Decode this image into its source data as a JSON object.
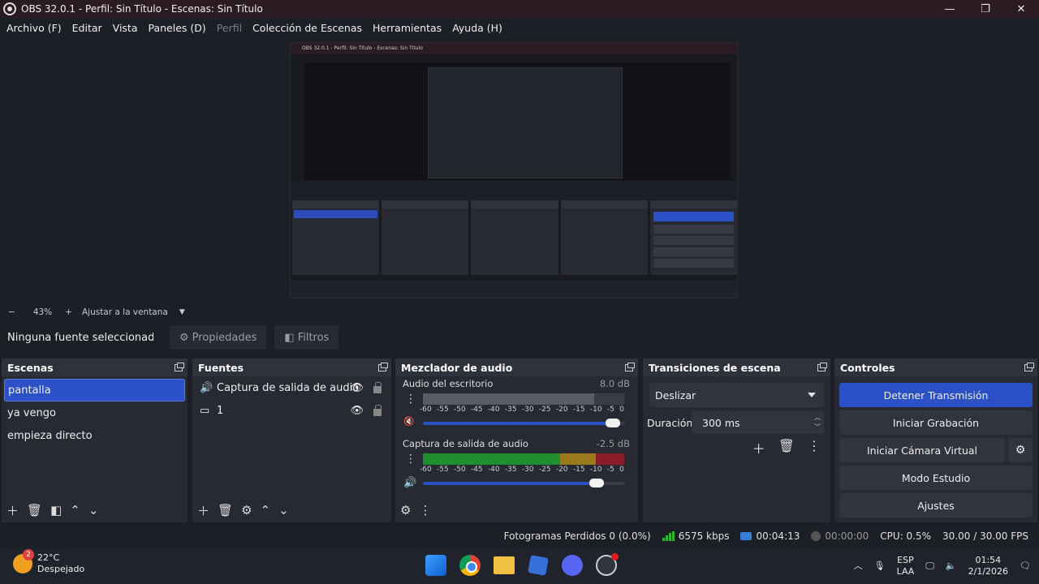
{
  "window": {
    "title": "OBS 32.0.1 - Perfil: Sin Título - Escenas: Sin Título",
    "minimize": "—",
    "maximize": "❐",
    "close": "✕"
  },
  "menu": {
    "items": [
      "Archivo (F)",
      "Editar",
      "Vista",
      "Paneles (D)",
      "Perfil",
      "Colección de Escenas",
      "Herramientas",
      "Ayuda (H)"
    ]
  },
  "zoom": {
    "minus": "−",
    "value": "43%",
    "plus": "+",
    "fit_label": "Ajustar a la ventana"
  },
  "source_toolbar": {
    "no_source": "Ninguna fuente seleccionada",
    "properties": "Propiedades",
    "filters": "Filtros"
  },
  "scenes": {
    "title": "Escenas",
    "items": [
      "pantalla",
      "ya vengo",
      "empieza directo"
    ],
    "selected_index": 0
  },
  "sources": {
    "title": "Fuentes",
    "items": [
      {
        "label": "Captura de salida de audio",
        "icon": "speaker-icon"
      },
      {
        "label": "1",
        "icon": "monitor-icon"
      }
    ]
  },
  "mixer": {
    "title": "Mezclador de audio",
    "ticks": [
      "-60",
      "-55",
      "-50",
      "-45",
      "-40",
      "-35",
      "-30",
      "-25",
      "-20",
      "-15",
      "-10",
      "-5",
      "0"
    ],
    "channels": [
      {
        "name": "Audio del escritorio",
        "db": "8.0 dB",
        "muted": true,
        "volume": 0.98,
        "level": 0.85
      },
      {
        "name": "Captura de salida de audio",
        "db": "-2.5 dB",
        "muted": false,
        "volume": 0.9,
        "level": 1.0
      }
    ]
  },
  "transitions": {
    "title": "Transiciones de escena",
    "selected": "Deslizar",
    "duration_label": "Duración",
    "duration_value": "300 ms"
  },
  "controls": {
    "title": "Controles",
    "stop_stream": "Detener Transmisión",
    "start_recording": "Iniciar Grabación",
    "start_virtual_cam": "Iniciar Cámara Virtual",
    "studio_mode": "Modo Estudio",
    "settings": "Ajustes"
  },
  "status": {
    "dropped_frames": "Fotogramas Perdidos 0 (0.0%)",
    "bitrate": "6575 kbps",
    "stream_time": "00:04:13",
    "rec_time": "00:00:00",
    "cpu": "CPU: 0.5%",
    "fps": "30.00 / 30.00 FPS"
  },
  "taskbar": {
    "weather_temp": "22°C",
    "weather_desc": "Despejado",
    "badge": "2",
    "lang_top": "ESP",
    "lang_bottom": "LAA",
    "time": "01:54",
    "date": "2/1/2026"
  },
  "preview": {
    "mini_title": "OBS 32.0.1 - Perfil: Sin Título - Escenas: Sin Título",
    "mini_source": "Ninguna fuente seleccionada"
  },
  "colors": {
    "accent": "#2c50c6",
    "panel": "#272a33",
    "background": "#1d1f26",
    "titlebar": "#2b1c24"
  }
}
